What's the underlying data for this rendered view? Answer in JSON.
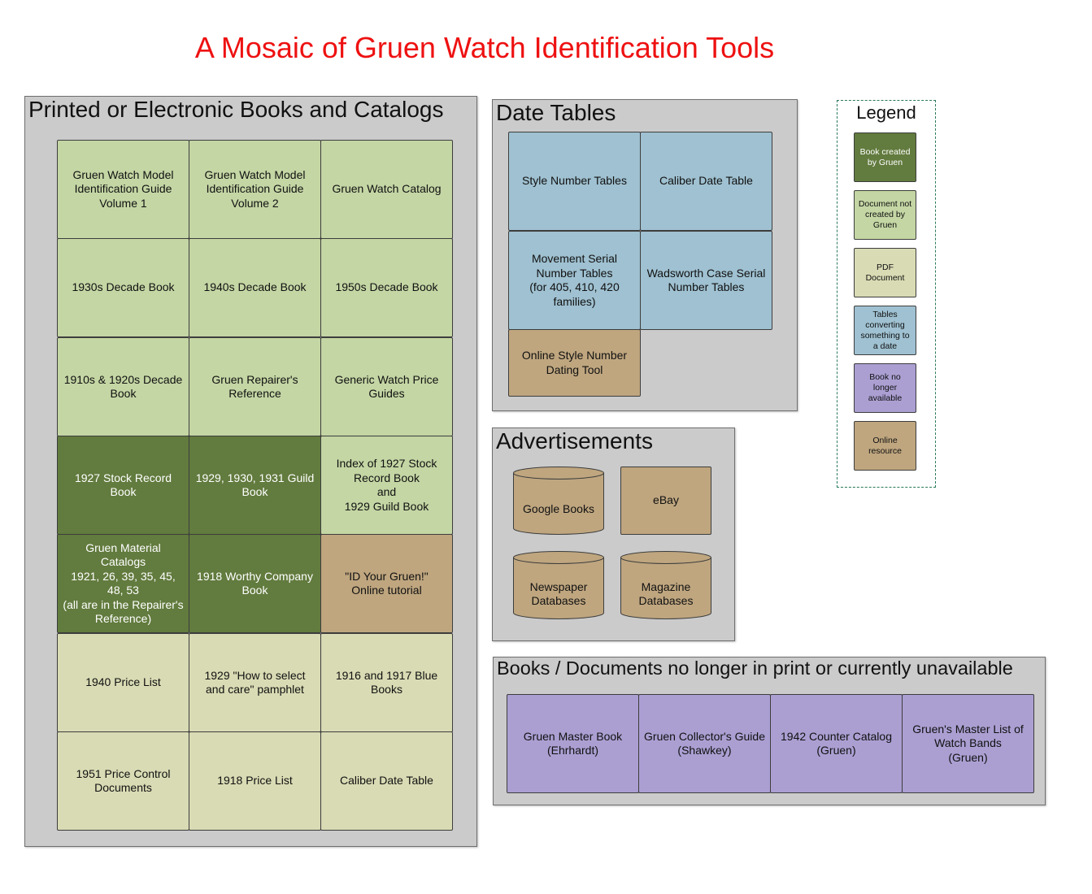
{
  "title": "A Mosaic of Gruen Watch Identification Tools",
  "colors": {
    "title": "#ee1111",
    "book_by_gruen": "#627b3e",
    "document_not_by_gruen": "#c4d6a4",
    "pdf_document": "#d9dbb4",
    "date_tables": "#9fc1d1",
    "no_longer_available": "#ab9fd2",
    "online_resource": "#bfa67f",
    "panel_background": "#cbcbcb"
  },
  "books_panel": {
    "title": "Printed or Electronic Books and Catalogs",
    "tiles": [
      {
        "label": "Gruen Watch Model\nIdentification Guide\nVolume 1",
        "category": "document_not_by_gruen"
      },
      {
        "label": "Gruen Watch Model\nIdentification Guide\nVolume 2",
        "category": "document_not_by_gruen"
      },
      {
        "label": "Gruen Watch Catalog",
        "category": "document_not_by_gruen"
      },
      {
        "label": "1930s Decade Book",
        "category": "document_not_by_gruen"
      },
      {
        "label": "1940s Decade Book",
        "category": "document_not_by_gruen"
      },
      {
        "label": "1950s Decade Book",
        "category": "document_not_by_gruen"
      },
      {
        "label": "1910s & 1920s Decade\nBook",
        "category": "document_not_by_gruen"
      },
      {
        "label": "Gruen Repairer's\nReference",
        "category": "document_not_by_gruen"
      },
      {
        "label": "Generic Watch Price\nGuides",
        "category": "document_not_by_gruen"
      },
      {
        "label": "1927 Stock Record\nBook",
        "category": "book_by_gruen"
      },
      {
        "label": "1929, 1930, 1931 Guild\nBook",
        "category": "book_by_gruen"
      },
      {
        "label": "Index of 1927 Stock\nRecord Book\nand\n1929 Guild Book",
        "category": "document_not_by_gruen"
      },
      {
        "label": "Gruen Material\nCatalogs\n1921, 26, 39, 35, 45,\n48, 53\n(all are in the Repairer's\nReference)",
        "category": "book_by_gruen"
      },
      {
        "label": "1918 Worthy Company\nBook",
        "category": "book_by_gruen"
      },
      {
        "label": "\"ID Your Gruen!\"\nOnline tutorial",
        "category": "online_resource"
      },
      {
        "label": "1940 Price List",
        "category": "pdf_document"
      },
      {
        "label": "1929 \"How to select\nand care\" pamphlet",
        "category": "pdf_document"
      },
      {
        "label": "1916 and 1917 Blue\nBooks",
        "category": "pdf_document"
      },
      {
        "label": "1951 Price Control\nDocuments",
        "category": "pdf_document"
      },
      {
        "label": "1918 Price List",
        "category": "pdf_document"
      },
      {
        "label": "Caliber Date Table",
        "category": "pdf_document"
      }
    ]
  },
  "date_tables_panel": {
    "title": "Date Tables",
    "tiles": [
      {
        "label": "Style Number Tables",
        "category": "date_tables"
      },
      {
        "label": "Caliber Date Table",
        "category": "date_tables"
      },
      {
        "label": "Movement Serial\nNumber Tables\n(for 405, 410, 420\nfamilies)",
        "category": "date_tables"
      },
      {
        "label": "Wadsworth Case Serial\nNumber Tables",
        "category": "date_tables"
      },
      {
        "label": "Online Style Number\nDating Tool",
        "category": "online_resource"
      }
    ]
  },
  "ads_panel": {
    "title": "Advertisements",
    "items": [
      {
        "label": "Google Books",
        "shape": "cylinder"
      },
      {
        "label": "eBay",
        "shape": "box"
      },
      {
        "label": "Newspaper\nDatabases",
        "shape": "cylinder"
      },
      {
        "label": "Magazine\nDatabases",
        "shape": "cylinder"
      }
    ]
  },
  "unavailable_panel": {
    "title": "Books / Documents no longer in print or currently unavailable",
    "tiles": [
      {
        "label": "Gruen Master Book\n(Ehrhardt)",
        "category": "no_longer_available"
      },
      {
        "label": "Gruen Collector's Guide\n(Shawkey)",
        "category": "no_longer_available"
      },
      {
        "label": "1942 Counter Catalog\n(Gruen)",
        "category": "no_longer_available"
      },
      {
        "label": "Gruen's Master List of\nWatch Bands\n(Gruen)",
        "category": "no_longer_available"
      }
    ]
  },
  "legend": {
    "title": "Legend",
    "items": [
      {
        "label": "Book created\nby Gruen",
        "category": "book_by_gruen"
      },
      {
        "label": "Document not\ncreated by\nGruen",
        "category": "document_not_by_gruen"
      },
      {
        "label": "PDF\nDocument",
        "category": "pdf_document"
      },
      {
        "label": "Tables\nconverting\nsomething to\na date",
        "category": "date_tables"
      },
      {
        "label": "Book no\nlonger\navailable",
        "category": "no_longer_available"
      },
      {
        "label": "Online\nresource",
        "category": "online_resource"
      }
    ]
  }
}
